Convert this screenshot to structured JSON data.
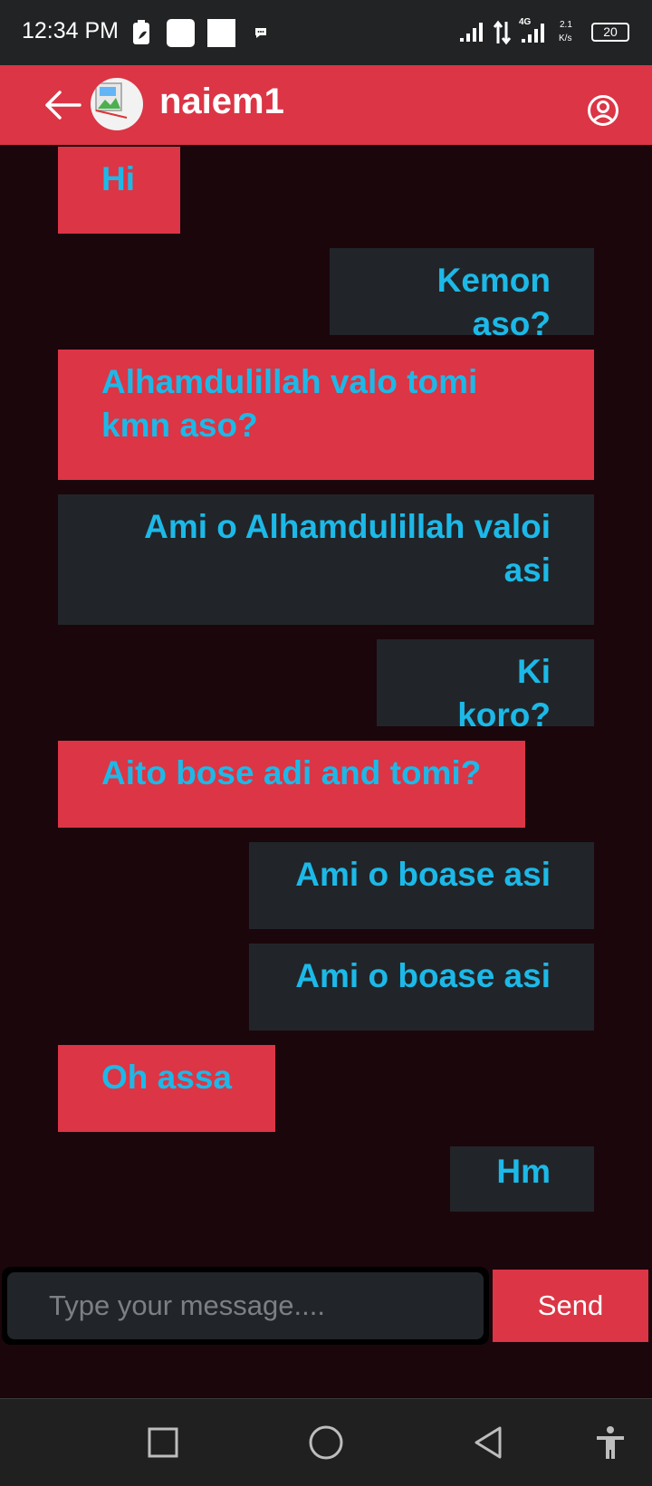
{
  "status_bar": {
    "time": "12:34 PM",
    "network_type": "4G",
    "speed_value": "2.1",
    "speed_unit": "K/s",
    "battery": "20"
  },
  "header": {
    "contact_name": "naiem1",
    "back_icon": "arrow-left-icon",
    "profile_icon": "user-circle-icon"
  },
  "messages": [
    {
      "text": "Hi",
      "direction": "received"
    },
    {
      "text": "Kemon aso?",
      "direction": "sent"
    },
    {
      "text": "Alhamdulillah valo tomi kmn aso?",
      "direction": "received"
    },
    {
      "text": "Ami o Alhamdulillah valoi asi",
      "direction": "sent"
    },
    {
      "text": "Ki koro?",
      "direction": "sent"
    },
    {
      "text": "Aito bose adi and tomi?",
      "direction": "received"
    },
    {
      "text": "Ami o boase asi",
      "direction": "sent"
    },
    {
      "text": "Ami o boase asi",
      "direction": "sent"
    },
    {
      "text": "Oh assa",
      "direction": "received"
    },
    {
      "text": "Hm",
      "direction": "sent"
    }
  ],
  "composer": {
    "placeholder": "Type your message....",
    "value": "",
    "send_label": "Send"
  },
  "colors": {
    "accent": "#dc3545",
    "background": "#1b060c",
    "sent_bubble": "#212529",
    "message_text": "#1cb9e8"
  },
  "nav_bar": {
    "buttons": [
      "recent-apps-icon",
      "home-icon",
      "back-triangle-icon",
      "accessibility-icon"
    ]
  }
}
